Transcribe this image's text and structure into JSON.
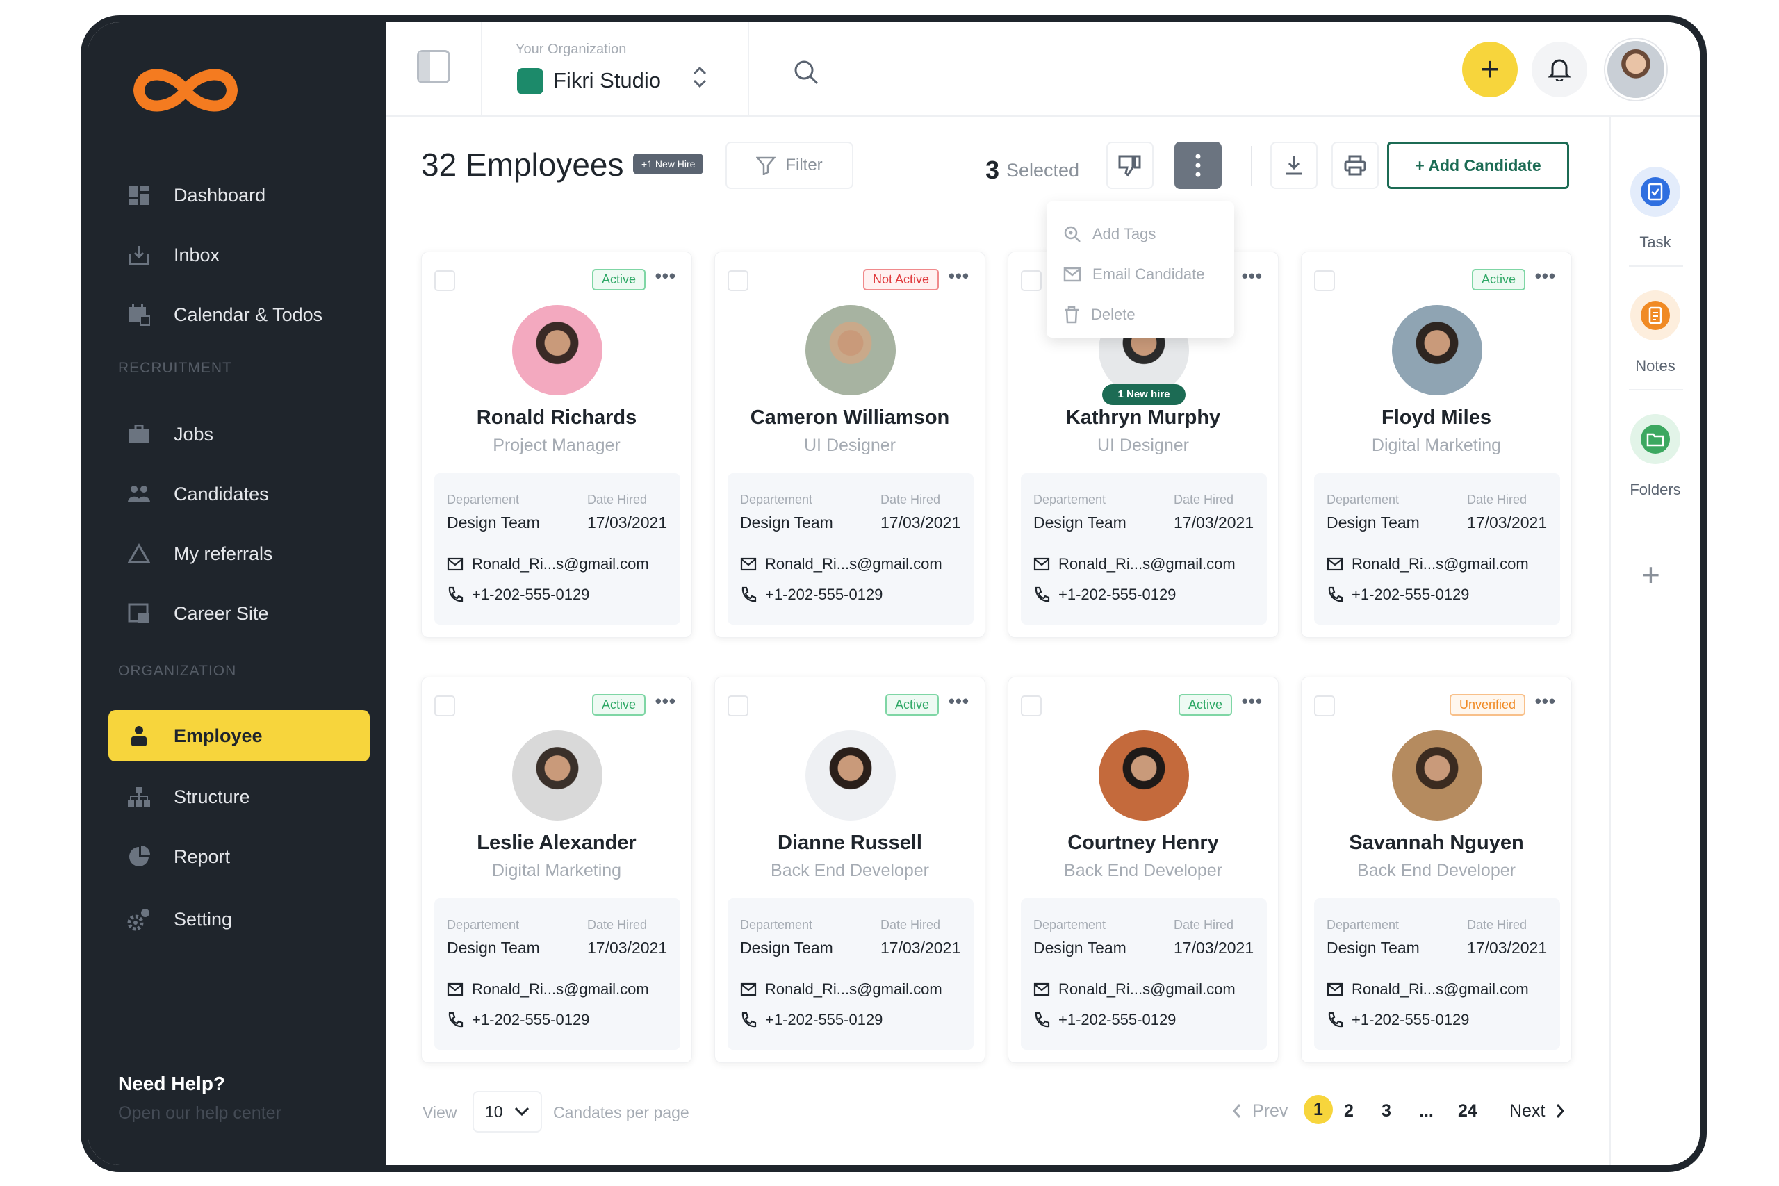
{
  "sidebar": {
    "items_main": [
      {
        "label": "Dashboard",
        "icon": "dashboard-icon"
      },
      {
        "label": "Inbox",
        "icon": "inbox-icon"
      },
      {
        "label": "Calendar & Todos",
        "icon": "calendar-icon"
      }
    ],
    "section_recruitment": "RECRUITMENT",
    "items_recruitment": [
      {
        "label": "Jobs",
        "icon": "briefcase-icon"
      },
      {
        "label": "Candidates",
        "icon": "people-icon"
      },
      {
        "label": "My referrals",
        "icon": "triangle-icon"
      },
      {
        "label": "Career Site",
        "icon": "career-site-icon"
      }
    ],
    "section_organization": "ORGANIZATION",
    "items_organization": [
      {
        "label": "Employee",
        "icon": "person-icon",
        "active": true
      },
      {
        "label": "Structure",
        "icon": "hierarchy-icon"
      },
      {
        "label": "Report",
        "icon": "pie-chart-icon"
      },
      {
        "label": "Setting",
        "icon": "gear-icon"
      }
    ],
    "help_title": "Need Help?",
    "help_sub": "Open our help center"
  },
  "topbar": {
    "org_label": "Your Organization",
    "org_name": "Fikri Studio",
    "add_symbol": "+"
  },
  "toolbar": {
    "title": "32 Employees",
    "new_hire_badge": "+1 New Hire",
    "filter_label": "Filter",
    "selected_count": "3",
    "selected_label": "Selected",
    "add_candidate": "+ Add Candidate"
  },
  "dropdown": {
    "items": [
      {
        "label": "Add Tags",
        "icon": "tag-icon"
      },
      {
        "label": "Email Candidate",
        "icon": "mail-icon"
      },
      {
        "label": "Delete",
        "icon": "trash-icon"
      }
    ]
  },
  "rail": {
    "task": "Task",
    "notes": "Notes",
    "folders": "Folders",
    "plus": "+"
  },
  "card_labels": {
    "department": "Departement",
    "date_hired": "Date Hired",
    "more": "•••"
  },
  "cards": [
    {
      "name": "Ronald Richards",
      "role": "Project Manager",
      "status": "Active",
      "department": "Design Team",
      "date": "17/03/2021",
      "email": "Ronald_Ri...s@gmail.com",
      "phone": "+1-202-555-0129"
    },
    {
      "name": "Cameron Williamson",
      "role": "UI Designer",
      "status": "Not Active",
      "department": "Design Team",
      "date": "17/03/2021",
      "email": "Ronald_Ri...s@gmail.com",
      "phone": "+1-202-555-0129"
    },
    {
      "name": "Kathryn Murphy",
      "role": "UI Designer",
      "status": "",
      "new_hire": "1 New hire",
      "department": "Design Team",
      "date": "17/03/2021",
      "email": "Ronald_Ri...s@gmail.com",
      "phone": "+1-202-555-0129"
    },
    {
      "name": "Floyd Miles",
      "role": "Digital Marketing",
      "status": "Active",
      "department": "Design Team",
      "date": "17/03/2021",
      "email": "Ronald_Ri...s@gmail.com",
      "phone": "+1-202-555-0129"
    },
    {
      "name": "Leslie Alexander",
      "role": "Digital Marketing",
      "status": "Active",
      "department": "Design Team",
      "date": "17/03/2021",
      "email": "Ronald_Ri...s@gmail.com",
      "phone": "+1-202-555-0129"
    },
    {
      "name": "Dianne Russell",
      "role": "Back End Developer",
      "status": "Active",
      "department": "Design Team",
      "date": "17/03/2021",
      "email": "Ronald_Ri...s@gmail.com",
      "phone": "+1-202-555-0129"
    },
    {
      "name": "Courtney Henry",
      "role": "Back End Developer",
      "status": "Active",
      "department": "Design Team",
      "date": "17/03/2021",
      "email": "Ronald_Ri...s@gmail.com",
      "phone": "+1-202-555-0129"
    },
    {
      "name": "Savannah Nguyen",
      "role": "Back End Developer",
      "status": "Unverified",
      "department": "Design Team",
      "date": "17/03/2021",
      "email": "Ronald_Ri...s@gmail.com",
      "phone": "+1-202-555-0129"
    }
  ],
  "footer": {
    "view_label": "View",
    "per_page_value": "10",
    "per_page_label": "Candates per page",
    "prev": "Prev",
    "pages": [
      "1",
      "2",
      "3",
      "...",
      "24"
    ],
    "current_page": "1",
    "next": "Next"
  },
  "colors": {
    "sidebar_bg": "#1f252c",
    "accent_yellow": "#f7d53c",
    "brand_orange": "#f47b20",
    "primary_green": "#1c6b54",
    "active_green": "#2fa866",
    "inactive_red": "#e0383b",
    "unverified_orange": "#f08a24"
  }
}
